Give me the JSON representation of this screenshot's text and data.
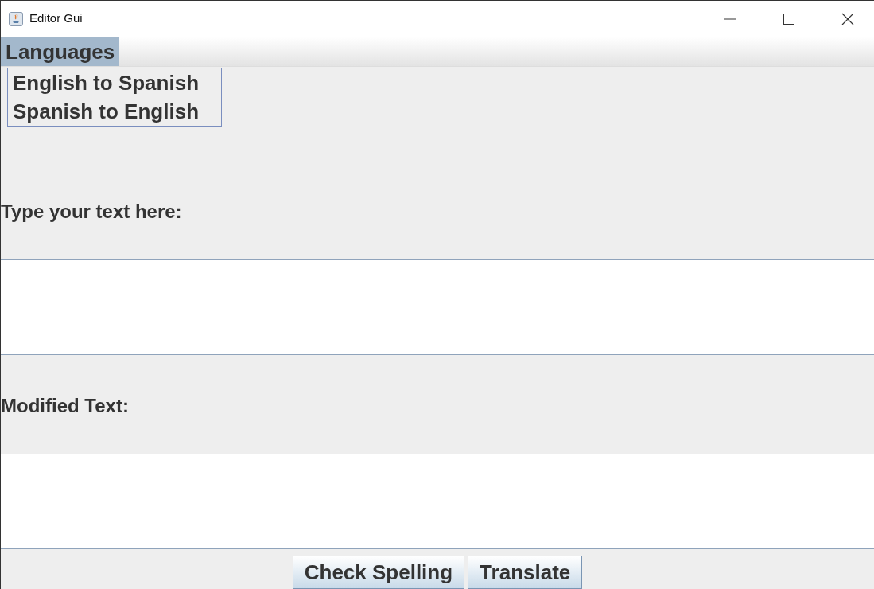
{
  "window": {
    "title": "Editor Gui"
  },
  "menu_bar": [
    {
      "label": "Languages",
      "selected": true
    }
  ],
  "open_menu": {
    "items": [
      {
        "label": "English to Spanish"
      },
      {
        "label": "Spanish to English"
      }
    ]
  },
  "input_label": "Type your text here:",
  "output_label": "Modified Text:",
  "buttons": [
    {
      "label": "Check Spelling"
    },
    {
      "label": "Translate"
    }
  ]
}
